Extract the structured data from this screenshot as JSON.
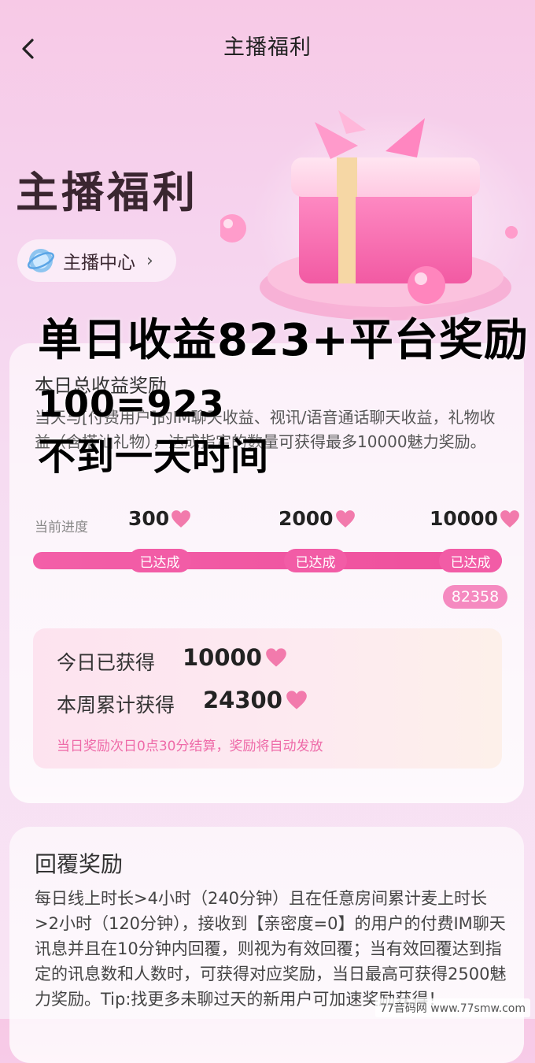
{
  "nav": {
    "title": "主播福利"
  },
  "hero": {
    "title": "主播福利",
    "center_link": "主播中心"
  },
  "overlay": {
    "line1": "单日收益823+平台奖励",
    "line2": "100=923",
    "line3": "不到一天时间"
  },
  "daily": {
    "title": "本日总收益奖励",
    "description": "当天与[付费用户]的IM聊天收益、视讯/语音通话聊天收益，礼物收益（含搭讪礼物），达成指定的数量可获得最多10000魅力奖励。",
    "progress_label": "当前进度",
    "milestones": [
      {
        "value": "300",
        "status": "已达成"
      },
      {
        "value": "2000",
        "status": "已达成"
      },
      {
        "value": "10000",
        "status": "已达成"
      }
    ],
    "current_value": "82358",
    "progress_fraction": 1.0,
    "today_label": "今日已获得",
    "today_value": "10000",
    "week_label": "本周累计获得",
    "week_value": "24300",
    "note": "当日奖励次日0点30分结算，奖励将自动发放"
  },
  "reply": {
    "title": "回覆奖励",
    "description": "每日线上时长>4小时（240分钟）且在任意房间累计麦上时长>2小时（120分钟），接收到【亲密度=0】的用户的付费IM聊天讯息并且在10分钟内回覆，则视为有效回覆；当有效回覆达到指定的讯息数和人数时，可获得对应奖励，当日最高可获得2500魅力奖励。Tip:找更多未聊过天的新用户可加速奖励获得！"
  },
  "watermark": "77音码网 www.77smw.com",
  "colors": {
    "accent": "#f25ca6",
    "heart": "#f27aac",
    "note": "#ee6aa8"
  },
  "icons": [
    "back-arrow-icon",
    "gift-box-icon",
    "globe-icon",
    "chevron-right-icon",
    "heart-icon"
  ]
}
